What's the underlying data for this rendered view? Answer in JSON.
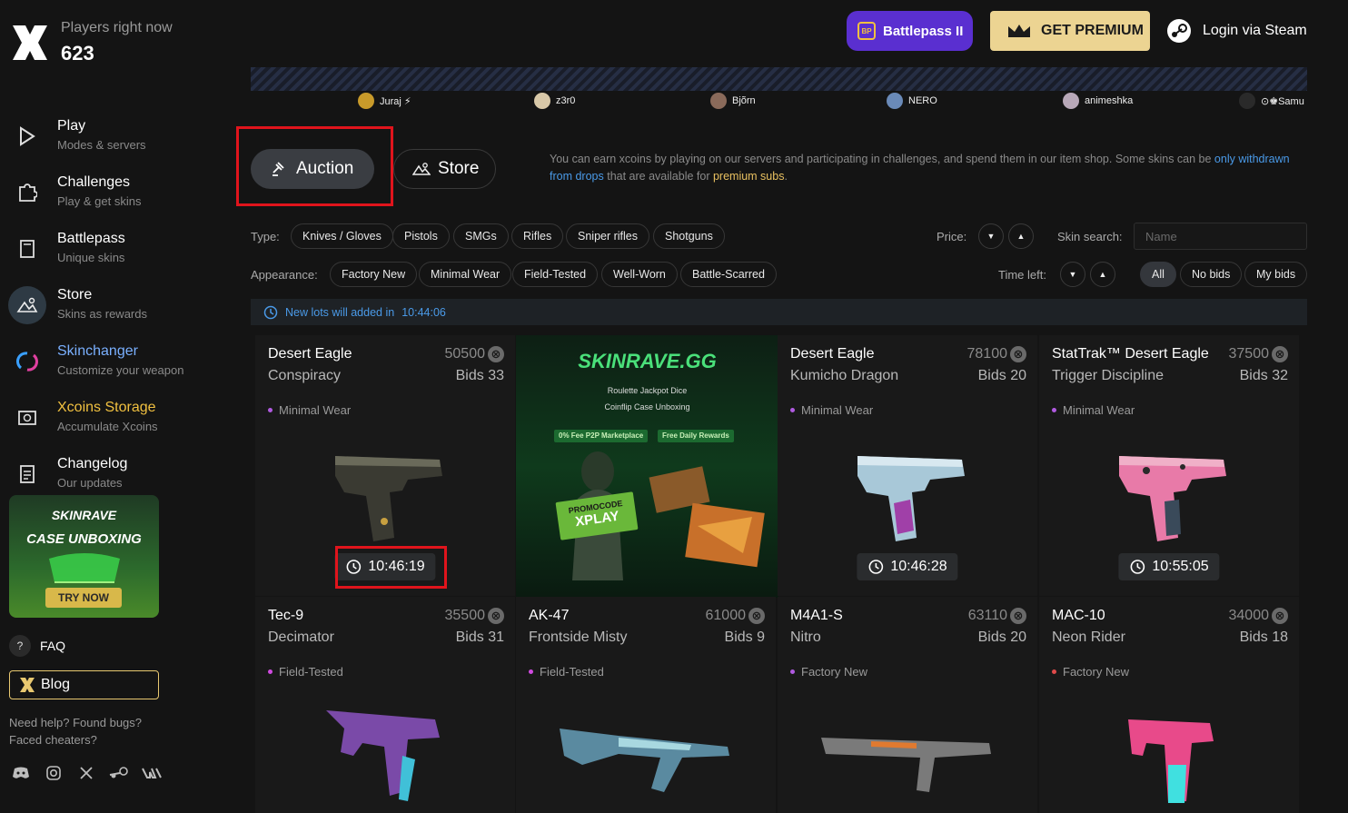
{
  "header": {
    "players_label": "Players right now",
    "players_count": "623",
    "battlepass_label": "Battlepass II",
    "battlepass_badge": "BP",
    "premium_label": "GET PREMIUM",
    "login_label": "Login via Steam"
  },
  "sidebar": {
    "items": [
      {
        "title": "Play",
        "sub": "Modes & servers",
        "color": "#ffffff"
      },
      {
        "title": "Challenges",
        "sub": "Play & get skins",
        "color": "#ffffff"
      },
      {
        "title": "Battlepass",
        "sub": "Unique skins",
        "color": "#ffffff"
      },
      {
        "title": "Store",
        "sub": "Skins as rewards",
        "color": "#ffffff"
      },
      {
        "title": "Skinchanger",
        "sub": "Customize your weapon",
        "color": "#7ab0ff"
      },
      {
        "title": "Xcoins Storage",
        "sub": "Accumulate Xcoins",
        "color": "#f0c040"
      },
      {
        "title": "Changelog",
        "sub": "Our updates",
        "color": "#ffffff"
      }
    ],
    "promo": {
      "brand": "SKINRAVE",
      "title": "CASE UNBOXING",
      "button": "TRY NOW"
    },
    "faq_icon": "?",
    "faq_label": "FAQ",
    "blog_label": "Blog",
    "help_text": "Need help? Found bugs? Faced cheaters?"
  },
  "strip": {
    "users": [
      "Juraj ⚡",
      "z3r0",
      "Bjõrn",
      "NERO",
      "animeshka",
      "⊙♚Samu"
    ]
  },
  "tabs": {
    "auction": "Auction",
    "store": "Store"
  },
  "info": {
    "part1": "You can earn xcoins by playing on our servers and participating in challenges, and spend them in our item shop. Some skins can be ",
    "link1": "only withdrawn from drops",
    "part2": " that are available for ",
    "link2": "premium subs",
    "part3": "."
  },
  "filters": {
    "type_label": "Type:",
    "types": [
      "Knives / Gloves",
      "Pistols",
      "SMGs",
      "Rifles",
      "Sniper rifles",
      "Shotguns"
    ],
    "appearance_label": "Appearance:",
    "appearances": [
      "Factory New",
      "Minimal Wear",
      "Field-Tested",
      "Well-Worn",
      "Battle-Scarred"
    ],
    "price_label": "Price:",
    "time_label": "Time left:",
    "skin_search_label": "Skin search:",
    "search_placeholder": "Name",
    "bid_filters": [
      "All",
      "No bids",
      "My bids"
    ],
    "active_bid_filter": "All"
  },
  "new_lots": {
    "label": "New lots will added in",
    "time": "10:44:06"
  },
  "items": [
    {
      "name": "Desert Eagle",
      "skin": "Conspiracy",
      "price": "50500",
      "bids": "Bids 33",
      "wear": "Minimal Wear",
      "wear_color": "#b05ae0",
      "timer": "10:46:19"
    },
    {
      "name": "Desert Eagle",
      "skin": "Kumicho Dragon",
      "price": "78100",
      "bids": "Bids 20",
      "wear": "Minimal Wear",
      "wear_color": "#b05ae0",
      "timer": "10:46:28"
    },
    {
      "name": "StatTrak™ Desert Eagle",
      "skin": "Trigger Discipline",
      "price": "37500",
      "bids": "Bids 32",
      "wear": "Minimal Wear",
      "wear_color": "#b05ae0",
      "timer": "10:55:05"
    },
    {
      "name": "Tec-9",
      "skin": "Decimator",
      "price": "35500",
      "bids": "Bids 31",
      "wear": "Field-Tested",
      "wear_color": "#d04ae0",
      "timer": ""
    },
    {
      "name": "AK-47",
      "skin": "Frontside Misty",
      "price": "61000",
      "bids": "Bids 9",
      "wear": "Field-Tested",
      "wear_color": "#d04ae0",
      "timer": ""
    },
    {
      "name": "M4A1-S",
      "skin": "Nitro",
      "price": "63110",
      "bids": "Bids 20",
      "wear": "Factory New",
      "wear_color": "#b05ae0",
      "timer": ""
    },
    {
      "name": "MAC-10",
      "skin": "Neon Rider",
      "price": "34000",
      "bids": "Bids 18",
      "wear": "Factory New",
      "wear_color": "#e04a4a",
      "timer": ""
    }
  ],
  "ad": {
    "brand": "SKINRAVE.GG",
    "line1": "Roulette   Jackpot   Dice",
    "line2": "Coinflip   Case Unboxing",
    "chip1": "0% Fee P2P Marketplace",
    "chip2": "Free Daily Rewards",
    "promo_label": "PROMOCODE",
    "promo_code": "XPLAY"
  },
  "icons": {
    "coin": "⊗",
    "clock": "clock-icon",
    "gavel": "gavel-icon"
  }
}
